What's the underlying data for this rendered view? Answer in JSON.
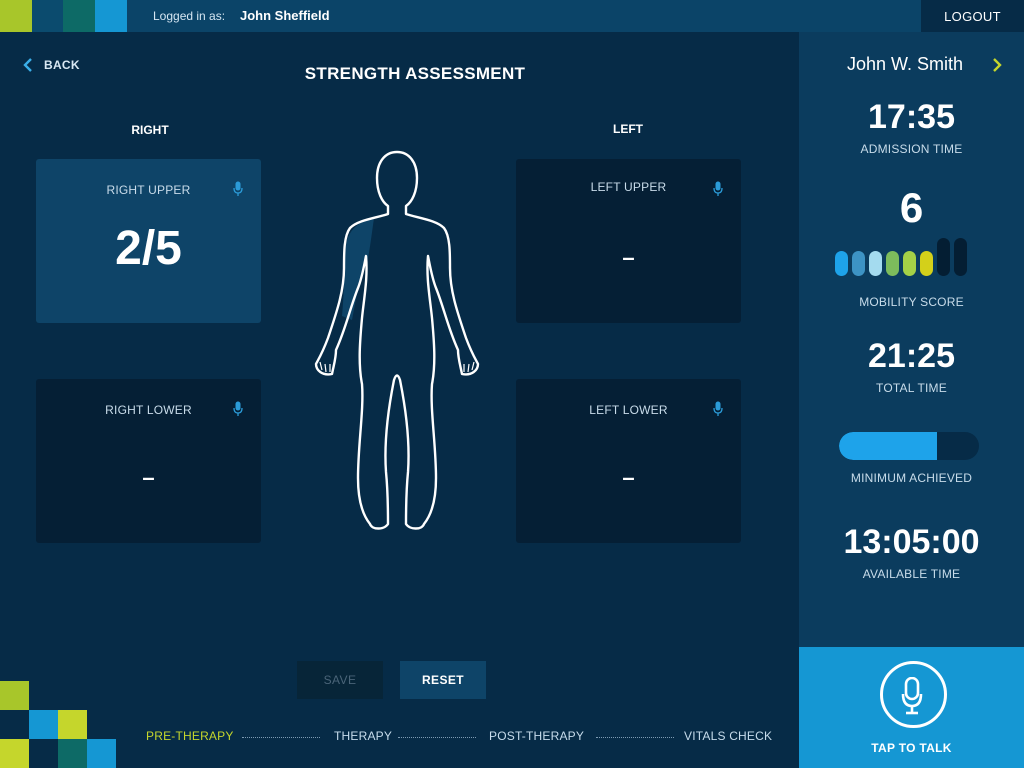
{
  "header": {
    "logged_in_label": "Logged in as:",
    "user_name": "John Sheffield",
    "logout_label": "LOGOUT",
    "logo_colors": [
      "#a8c62a",
      "#0b4b6e",
      "#0d6a66",
      "#1597d3"
    ]
  },
  "main": {
    "back_label": "BACK",
    "title": "STRENGTH ASSESSMENT",
    "right_label": "RIGHT",
    "left_label": "LEFT",
    "cards": {
      "right_upper": {
        "title": "RIGHT UPPER",
        "value": "2/5"
      },
      "left_upper": {
        "title": "LEFT UPPER",
        "value": "–"
      },
      "right_lower": {
        "title": "RIGHT LOWER",
        "value": "–"
      },
      "left_lower": {
        "title": "LEFT LOWER",
        "value": "–"
      }
    },
    "save_label": "SAVE",
    "reset_label": "RESET",
    "steps": [
      {
        "label": "PRE-THERAPY",
        "state": "current"
      },
      {
        "label": "THERAPY",
        "state": "pending"
      },
      {
        "label": "POST-THERAPY",
        "state": "pending"
      },
      {
        "label": "VITALS CHECK",
        "state": "pending"
      }
    ]
  },
  "panel": {
    "patient_name": "John W. Smith",
    "admission_time": "17:35",
    "admission_label": "ADMISSION TIME",
    "mobility_score": "6",
    "mobility_max": 8,
    "mobility_colors": [
      "#1ea3ea",
      "#3d93c4",
      "#a4dbef",
      "#7dbc5c",
      "#a5d147",
      "#d4d01a",
      "#041e33",
      "#041e33"
    ],
    "mobility_label": "MOBILITY SCORE",
    "total_time": "21:25",
    "total_label": "TOTAL TIME",
    "minimum_progress": 0.7,
    "minimum_label": "MINIMUM ACHIEVED",
    "available_time": "13:05:00",
    "available_label": "AVAILABLE TIME",
    "talk_label": "TAP TO TALK",
    "accent_color": "#1597d3",
    "highlight_color": "#c5d62c"
  }
}
